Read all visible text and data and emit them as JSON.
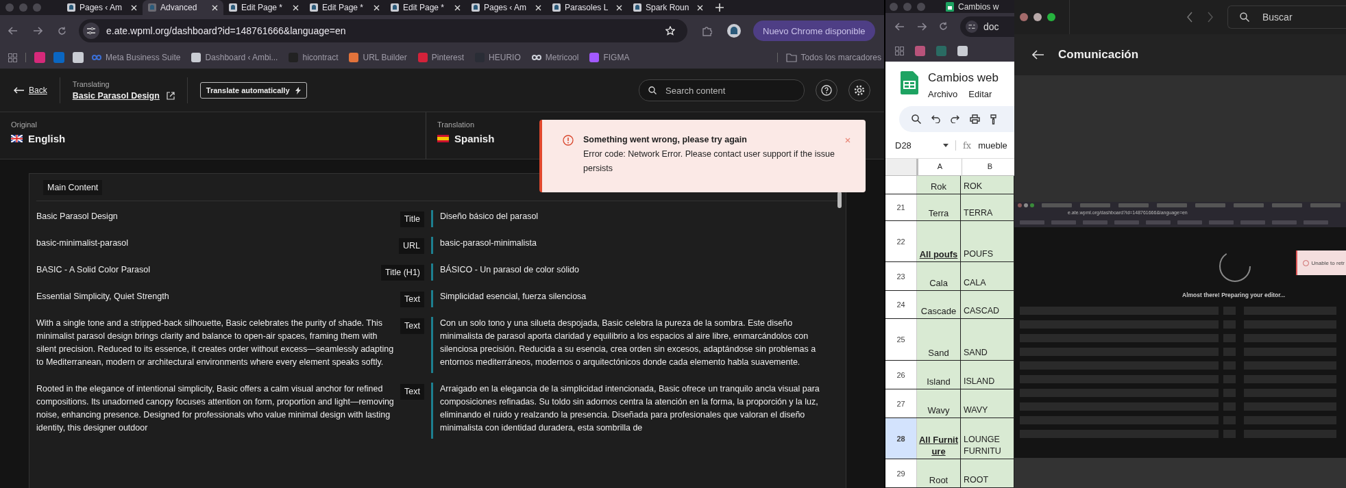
{
  "browser": {
    "tabs": [
      {
        "label": "Pages ‹ Am",
        "selected": false
      },
      {
        "label": "Advanced",
        "selected": true
      },
      {
        "label": "Edit Page *",
        "selected": false
      },
      {
        "label": "Edit Page *",
        "selected": false
      },
      {
        "label": "Edit Page *",
        "selected": false
      },
      {
        "label": "Pages ‹ Am",
        "selected": false
      },
      {
        "label": "Parasoles L",
        "selected": false
      },
      {
        "label": "Spark Roun",
        "selected": false
      }
    ],
    "url": "e.ate.wpml.org/dashboard?id=148761666&language=en",
    "update_button": "Nuevo Chrome disponible",
    "bookmarks": [
      {
        "kind": "instagram"
      },
      {
        "kind": "linkedin"
      },
      {
        "kind": "site"
      },
      {
        "kind": "meta",
        "label": "Meta Business Suite"
      },
      {
        "kind": "site",
        "label": "Dashboard ‹ Ambi..."
      },
      {
        "kind": "hi",
        "label": "hicontract"
      },
      {
        "kind": "badge",
        "label": "URL Builder"
      },
      {
        "kind": "pinterest",
        "label": "Pinterest"
      },
      {
        "kind": "heurio",
        "label": "HEURIO"
      },
      {
        "kind": "infinity",
        "label": "Metricool"
      },
      {
        "kind": "figma",
        "label": "FIGMA"
      }
    ],
    "all_bookmarks": "Todos los marcadores"
  },
  "editor": {
    "back": "Back",
    "translating_label": "Translating",
    "page_title": "Basic Parasol Design",
    "translate_button": "Translate automatically",
    "search": {
      "placeholder": "Search content"
    },
    "original": {
      "label": "Original",
      "language": "English"
    },
    "translation": {
      "label": "Translation",
      "language": "Spanish"
    },
    "section": "Main Content",
    "rows": [
      {
        "source": "Basic Parasol Design",
        "type": "Title",
        "target": "Diseño básico del parasol"
      },
      {
        "source": "basic-minimalist-parasol",
        "type": "URL",
        "target": "basic-parasol-minimalista"
      },
      {
        "source": "BASIC - A Solid Color Parasol",
        "type": "Title (H1)",
        "target": "BÁSICO - Un parasol de color sólido"
      },
      {
        "source": "Essential Simplicity, Quiet Strength",
        "type": "Text",
        "target": "Simplicidad esencial, fuerza silenciosa"
      },
      {
        "source": "With a single tone and a stripped-back silhouette, Basic celebrates the purity of shade. This minimalist parasol design brings clarity and balance to open-air spaces, framing them with silent precision. Reduced to its essence, it creates order without excess—seamlessly adapting to Mediterranean, modern or architectural environments where every element speaks softly.",
        "type": "Text",
        "target": "Con un solo tono y una silueta despojada, Basic celebra la pureza de la sombra. Este diseño minimalista de parasol aporta claridad y equilibrio a los espacios al aire libre, enmarcándolos con silenciosa precisión. Reducida a su esencia, crea orden sin excesos, adaptándose sin problemas a entornos mediterráneos, modernos o arquitectónicos donde cada elemento habla suavemente."
      },
      {
        "source": "Rooted in the elegance of intentional simplicity, Basic offers a calm visual anchor for refined compositions. Its unadorned canopy focuses attention on form, proportion and light—removing noise, enhancing presence. Designed for professionals who value minimal design with lasting identity, this designer outdoor",
        "type": "Text",
        "target": "Arraigado en la elegancia de la simplicidad intencionada, Basic ofrece un tranquilo ancla visual para composiciones refinadas. Su toldo sin adornos centra la atención en la forma, la proporción y la luz, eliminando el ruido y realzando la presencia. Diseñada para profesionales que valoran el diseño minimalista con identidad duradera, esta sombrilla de"
      }
    ]
  },
  "toast": {
    "title": "Something went wrong, please try again",
    "message": "Error code: Network Error. Please contact user support if the issue persists"
  },
  "sheet": {
    "tab": "Cambios w",
    "url": "doc",
    "title": "Cambios web",
    "menus": [
      "Archivo",
      "Editar"
    ],
    "cell_ref": "D28",
    "function_label": "fx",
    "formula": "mueble",
    "columns": [
      "A",
      "B"
    ],
    "rows": [
      {
        "number": "",
        "a": "Rok",
        "b": "ROK",
        "link": false,
        "selected": false
      },
      {
        "number": "21",
        "a": "Terra",
        "b": "TERRA",
        "link": false,
        "selected": false
      },
      {
        "number": "22",
        "a": "All poufs",
        "b": "POUFS",
        "link": true,
        "selected": false
      },
      {
        "number": "23",
        "a": "Cala",
        "b": "CALA",
        "link": false,
        "selected": false
      },
      {
        "number": "24",
        "a": "Cascade",
        "b": "CASCAD",
        "link": false,
        "selected": false
      },
      {
        "number": "25",
        "a": "Sand",
        "b": "SAND",
        "link": false,
        "selected": false
      },
      {
        "number": "26",
        "a": "Island",
        "b": "ISLAND",
        "link": false,
        "selected": false
      },
      {
        "number": "27",
        "a": "Wavy",
        "b": "WAVY",
        "link": false,
        "selected": false
      },
      {
        "number": "28",
        "a": "All Furniture",
        "b": "LOUNGE FURNITU",
        "link": true,
        "selected": true
      },
      {
        "number": "29",
        "a": "Root",
        "b": "ROOT",
        "link": false,
        "selected": false
      }
    ]
  },
  "messenger": {
    "search": {
      "placeholder": "Buscar"
    },
    "title": "Comunicación",
    "preview": {
      "url": "e.ate.wpml.org/dashboard?id=148761666&language=en",
      "loading": "Almost there! Preparing your editor...",
      "toast": "Unable to retr"
    }
  }
}
